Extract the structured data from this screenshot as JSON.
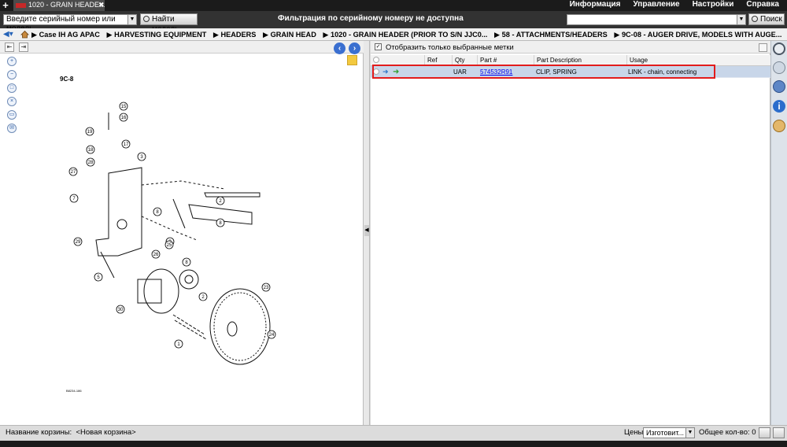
{
  "window": {
    "new_tab_symbol": "+",
    "active_tab": "1020 - GRAIN HEADE...",
    "tab_close": "✖"
  },
  "menu": [
    "Информация",
    "Управление",
    "Настройки",
    "Справка"
  ],
  "toolbar": {
    "serial_placeholder": "Введите серийный номер или модель",
    "find_model_button": "Найти модель",
    "filter_message": "Фильтрация по серийному номеру не доступна",
    "search_value": "",
    "search_button": "Поиск"
  },
  "breadcrumb": [
    "Case IH AG APAC",
    "HARVESTING EQUIPMENT",
    "HEADERS",
    "GRAIN HEAD",
    "1020 - GRAIN HEADER (PRIOR TO S/N JJC0...",
    "58 - ATTACHMENTS/HEADERS",
    "9C-08 - AUGER DRIVE, MODELS WITH AUGE..."
  ],
  "diagram": {
    "label": "9C-8",
    "code": "B8234-186",
    "callouts": [
      "15",
      "16",
      "19",
      "18",
      "17",
      "3",
      "28",
      "27",
      "7",
      "2",
      "8",
      "3",
      "8",
      "26",
      "29",
      "5",
      "8",
      "2",
      "25",
      "30",
      "1",
      "24",
      "23",
      "12",
      "13"
    ]
  },
  "parts_panel": {
    "show_selected_label": "Отобразить только выбранные метки",
    "show_selected_checked": true,
    "columns": [
      "Ref",
      "Qty",
      "Part #",
      "Part Description",
      "Usage"
    ],
    "rows": [
      {
        "ref": "",
        "qty": "UAR",
        "part_no": "574532R91",
        "description": "CLIP, SPRING",
        "usage": "LINK - chain, connecting",
        "selected": true
      }
    ]
  },
  "bottom": {
    "basket_label": "Название корзины:",
    "basket_value": "<Новая корзина>",
    "prices_label": "Цены:",
    "prices_value": "Изготовит...",
    "total_label": "Общее кол-во: 0"
  },
  "colors": {
    "highlight": "#e31c1c",
    "link": "#0000ee",
    "selected_row": "#c8d6e9"
  }
}
